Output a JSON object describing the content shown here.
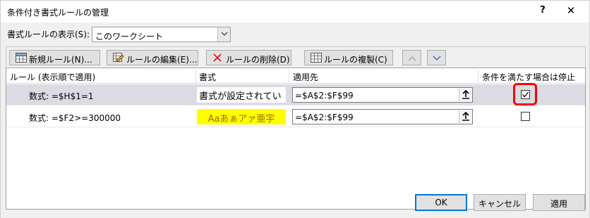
{
  "window": {
    "title": "条件付き書式ルールの管理",
    "help_label": "?",
    "close_label": "✕"
  },
  "show_rules": {
    "label": "書式ルールの表示(S):",
    "value": "このワークシート"
  },
  "toolbar": {
    "new_rule": "新規ルール(N)...",
    "edit_rule": "ルールの編集(E)...",
    "delete_rule": "ルールの削除(D)",
    "duplicate_rule": "ルールの複製(C)"
  },
  "table": {
    "headers": {
      "rule": "ルール (表示順で適用)",
      "format": "書式",
      "applies_to": "適用先",
      "stop_if_true": "条件を満たす場合は停止"
    },
    "rows": [
      {
        "rule": "数式: =$H$1=1",
        "format_preview": "書式が設定されてい",
        "applies_to": "=$A$2:$F$99",
        "stop_if_true": true,
        "selected": true
      },
      {
        "rule": "数式: =$F2>=300000",
        "format_preview": "Aaあぁアァ亜宇",
        "applies_to": "=$A$2:$F$99",
        "stop_if_true": false,
        "selected": false
      }
    ]
  },
  "buttons": {
    "ok": "OK",
    "cancel": "キャンセル",
    "apply": "適用"
  },
  "colors": {
    "highlight_box": "#ff0000",
    "format_fill": "#ffff00",
    "format_text": "#9c6500",
    "selected_row": "#dadbe3"
  }
}
